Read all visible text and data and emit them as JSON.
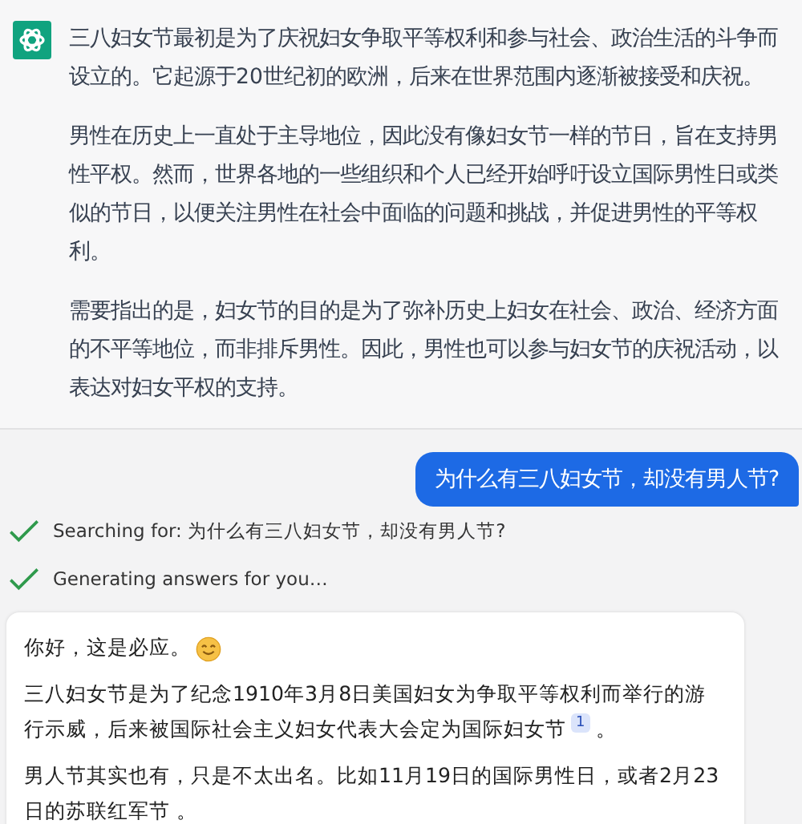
{
  "previous_answer": {
    "paragraphs": [
      "三八妇女节最初是为了庆祝妇女争取平等权利和参与社会、政治生活的斗争而设立的。它起源于20世纪初的欧洲，后来在世界范围内逐渐被接受和庆祝。",
      "男性在历史上一直处于主导地位，因此没有像妇女节一样的节日，旨在支持男性平权。然而，世界各地的一些组织和个人已经开始呼吁设立国际男性日或类似的节日，以便关注男性在社会中面临的问题和挑战，并促进男性的平等权利。",
      "需要指出的是，妇女节的目的是为了弥补历史上妇女在社会、政治、经济方面的不平等地位，而非排斥男性。因此，男性也可以参与妇女节的庆祝活动，以表达对妇女平权的支持。"
    ]
  },
  "user_message": "为什么有三八妇女节，却没有男人节?",
  "progress_steps": [
    {
      "text": "Searching for: 为什么有三八妇女节，却没有男人节?",
      "done": true
    },
    {
      "text": "Generating answers for you…",
      "done": true
    }
  ],
  "answer": {
    "paragraphs": [
      {
        "text": "你好，这是必应。",
        "emoji": true
      },
      {
        "text": "三八妇女节是为了纪念1910年3月8日美国妇女为争取平等权利而举行的游行示威，后来被国际社会主义妇女代表大会定为国际妇女节",
        "footnote": "1",
        "after": " 。"
      },
      {
        "text": "男人节其实也有，只是不太出名。比如11月19日的国际男性日，或者2月23日的苏联红军节 。"
      }
    ]
  }
}
